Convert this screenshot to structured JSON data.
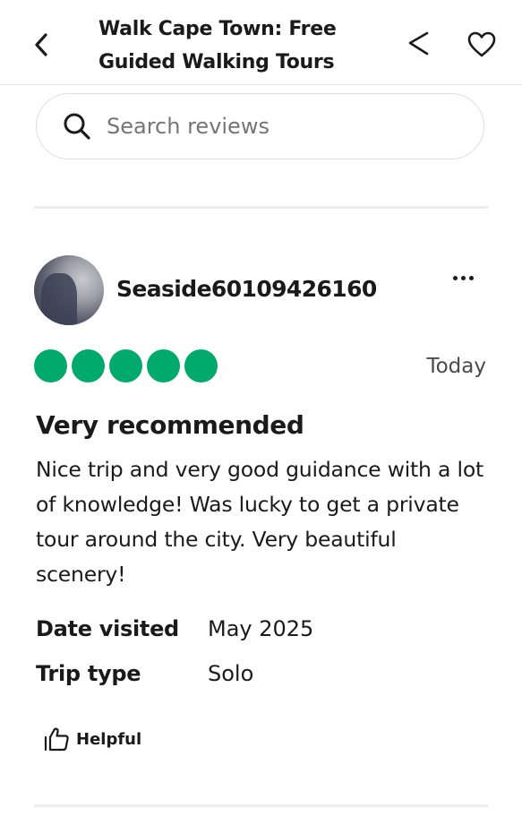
{
  "header": {
    "title": "Walk Cape Town: Free Guided Walking Tours",
    "back_icon": "chevron-left-icon",
    "share_icon": "share-icon",
    "favorite_icon": "heart-icon"
  },
  "search": {
    "placeholder": "Search reviews",
    "value": "",
    "icon": "search-icon"
  },
  "review": {
    "username": "Seaside60109426160",
    "rating": 5,
    "rating_max": 5,
    "rating_color": "#00aa6c",
    "date": "Today",
    "title": "Very recommended",
    "body": "Nice trip and very good guidance with a lot of knowledge! Was lucky to get a private tour around the city. Very beautiful scenery!",
    "details": [
      {
        "label": "Date visited",
        "value": "May 2025"
      },
      {
        "label": "Trip type",
        "value": "Solo"
      }
    ],
    "helpful_label": "Helpful",
    "helpful_icon": "thumbs-up-icon",
    "more_icon": "more-horizontal-icon"
  }
}
